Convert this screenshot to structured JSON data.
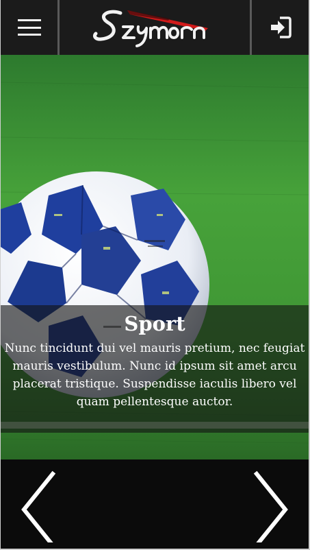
{
  "header": {
    "menu_icon": "hamburger-menu-icon",
    "logo_text": "Szymon",
    "login_icon": "sign-in-icon",
    "accent_color": "#d11a1a"
  },
  "hero": {
    "title": "Sport",
    "description": "Nunc tincidunt dui vel mauris pretium, nec feugiat mauris vestibulum. Nunc id ipsum sit amet arcu placerat tristique. Suspendisse iaculis libero vel quam pellentesque auctor."
  },
  "carousel": {
    "prev_icon": "chevron-left-icon",
    "next_icon": "chevron-right-icon"
  }
}
